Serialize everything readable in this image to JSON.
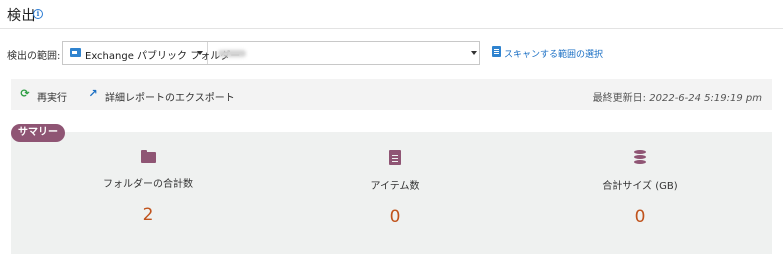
{
  "header": {
    "title": "検出",
    "info_icon": "i"
  },
  "scope": {
    "label": "検出の範囲:",
    "source": "Exchange パブリック フォルダー",
    "select_link": "スキャンする範囲の選択"
  },
  "toolbar": {
    "rerun_label": "再実行",
    "export_label": "詳細レポートのエクスポート",
    "last_update_label": "最終更新日:",
    "last_update_value": "2022-6-24 5:19:19 pm"
  },
  "summary": {
    "badge": "サマリー",
    "stats": [
      {
        "label": "フォルダーの合計数",
        "value": "2",
        "icon": "folder-icon"
      },
      {
        "label": "アイテム数",
        "value": "0",
        "icon": "file-icon"
      },
      {
        "label": "合計サイズ (GB)",
        "value": "0",
        "icon": "database-icon"
      }
    ]
  },
  "colors": {
    "accent": "#8f5574",
    "value": "#c0531c",
    "link": "#1a6fc4"
  }
}
